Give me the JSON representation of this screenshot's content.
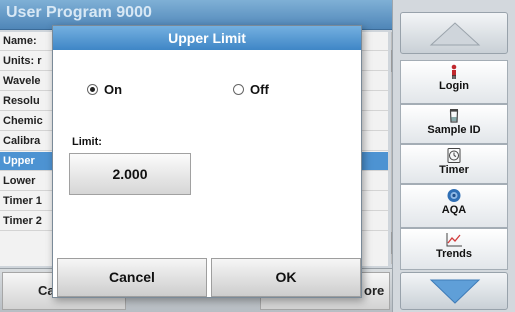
{
  "background": {
    "title": "User Program 9000",
    "params": [
      {
        "label": "Name:",
        "selected": false
      },
      {
        "label": "Units: r",
        "selected": false
      },
      {
        "label": "Wavele",
        "selected": false
      },
      {
        "label": "Resolu",
        "selected": false
      },
      {
        "label": "Chemic",
        "selected": false
      },
      {
        "label": "Calibra",
        "selected": false
      },
      {
        "label": "Upper",
        "selected": true
      },
      {
        "label": "Lower",
        "selected": false
      },
      {
        "label": "Timer 1",
        "selected": false
      },
      {
        "label": "Timer 2",
        "selected": false
      }
    ],
    "bottom_left": "Ca",
    "bottom_right": "ore"
  },
  "toolbar": {
    "login": "Login",
    "sample_id": "Sample ID",
    "timer": "Timer",
    "aqa": "AQA",
    "trends": "Trends"
  },
  "dialog": {
    "title": "Upper Limit",
    "on_label": "On",
    "off_label": "Off",
    "selected_option": "On",
    "limit_label": "Limit:",
    "limit_value": "2.000",
    "cancel": "Cancel",
    "ok": "OK"
  },
  "colors": {
    "accent": "#3f86c6",
    "selected_row": "#4d93d2",
    "nav_arrow": "#5f9fd8"
  },
  "icons": [
    "scroll-up-icon",
    "scroll-down-icon",
    "nav-up-icon",
    "nav-down-icon",
    "login-icon",
    "sample-id-icon",
    "timer-icon",
    "aqa-icon",
    "trends-icon"
  ]
}
